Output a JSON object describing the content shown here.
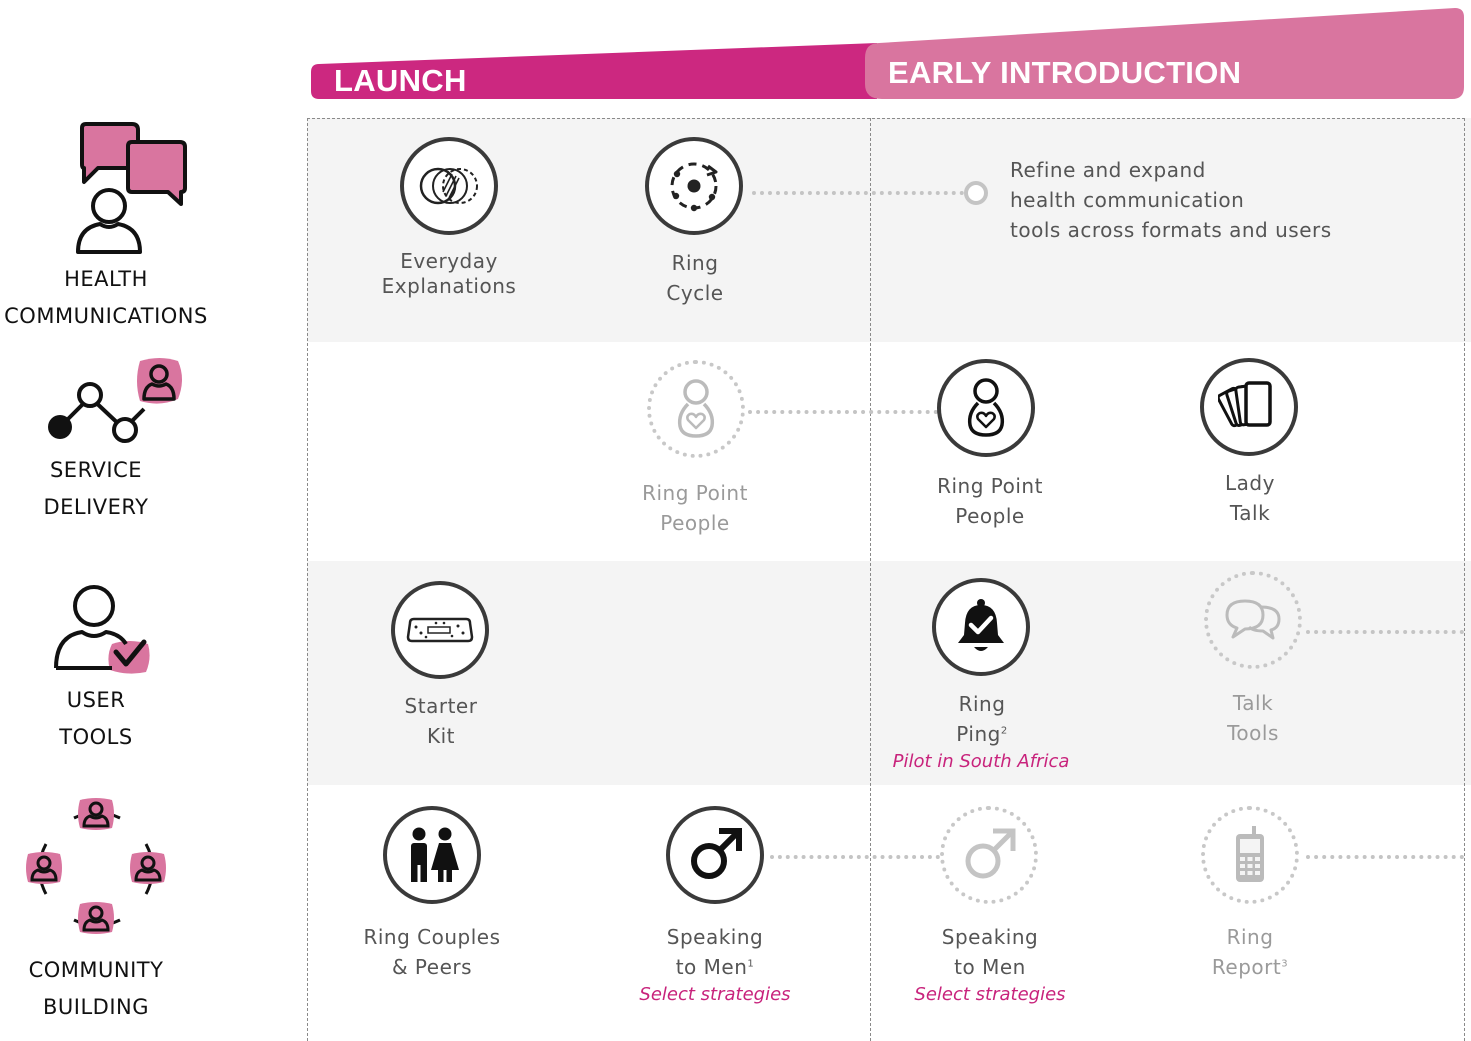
{
  "phases": {
    "launch": "LAUNCH",
    "early": "EARLY INTRODUCTION"
  },
  "colors": {
    "launch": "#cc2880",
    "early": "#d9759f",
    "accent_italic": "#c8237c",
    "row_grey": "#f4f4f4"
  },
  "categories": [
    {
      "line1": "HEALTH",
      "line2": "COMMUNICATIONS",
      "icon": "speech-bubbles-person-icon"
    },
    {
      "line1": "SERVICE",
      "line2": "DELIVERY",
      "icon": "network-person-icon"
    },
    {
      "line1": "USER",
      "line2": "TOOLS",
      "icon": "person-checkmark-icon"
    },
    {
      "line1": "COMMUNITY",
      "line2": "BUILDING",
      "icon": "people-circle-icon"
    }
  ],
  "rows": {
    "health": {
      "everyday": {
        "line1": "Everyday",
        "line2": "Explanations",
        "icon": "overlapping-circles-icon"
      },
      "ring_cycle": {
        "line1": "Ring",
        "line2": "Cycle",
        "icon": "ring-cycle-icon"
      },
      "refine": {
        "line1": "Refine and expand",
        "line2": "health communication",
        "line3": "tools across formats and users"
      }
    },
    "service": {
      "rpp_launch": {
        "line1": "Ring Point",
        "line2": "People",
        "icon": "pregnant-person-heart-icon"
      },
      "rpp_early": {
        "line1": "Ring Point",
        "line2": "People",
        "icon": "pregnant-person-heart-icon"
      },
      "lady_talk": {
        "line1": "Lady",
        "line2": "Talk",
        "icon": "card-deck-icon"
      }
    },
    "user_tools": {
      "starter_kit": {
        "line1": "Starter",
        "line2": "Kit",
        "icon": "ring-case-icon"
      },
      "ring_ping": {
        "line1": "Ring",
        "line2": "Ping",
        "sup": "2",
        "note": "Pilot in South Africa",
        "icon": "bell-check-icon"
      },
      "talk_tools": {
        "line1": "Talk",
        "line2": "Tools",
        "icon": "speech-bubbles-icon"
      }
    },
    "community": {
      "couples": {
        "line1": "Ring Couples",
        "line2": "& Peers",
        "icon": "man-woman-icon"
      },
      "men_launch": {
        "line1": "Speaking",
        "line2": "to Men",
        "sup": "1",
        "note": "Select strategies",
        "icon": "male-symbol-icon"
      },
      "men_early": {
        "line1": "Speaking",
        "line2": "to Men",
        "note": "Select strategies",
        "icon": "male-symbol-icon"
      },
      "ring_report": {
        "line1": "Ring",
        "line2": "Report",
        "sup": "3",
        "icon": "mobile-phone-icon"
      }
    }
  }
}
